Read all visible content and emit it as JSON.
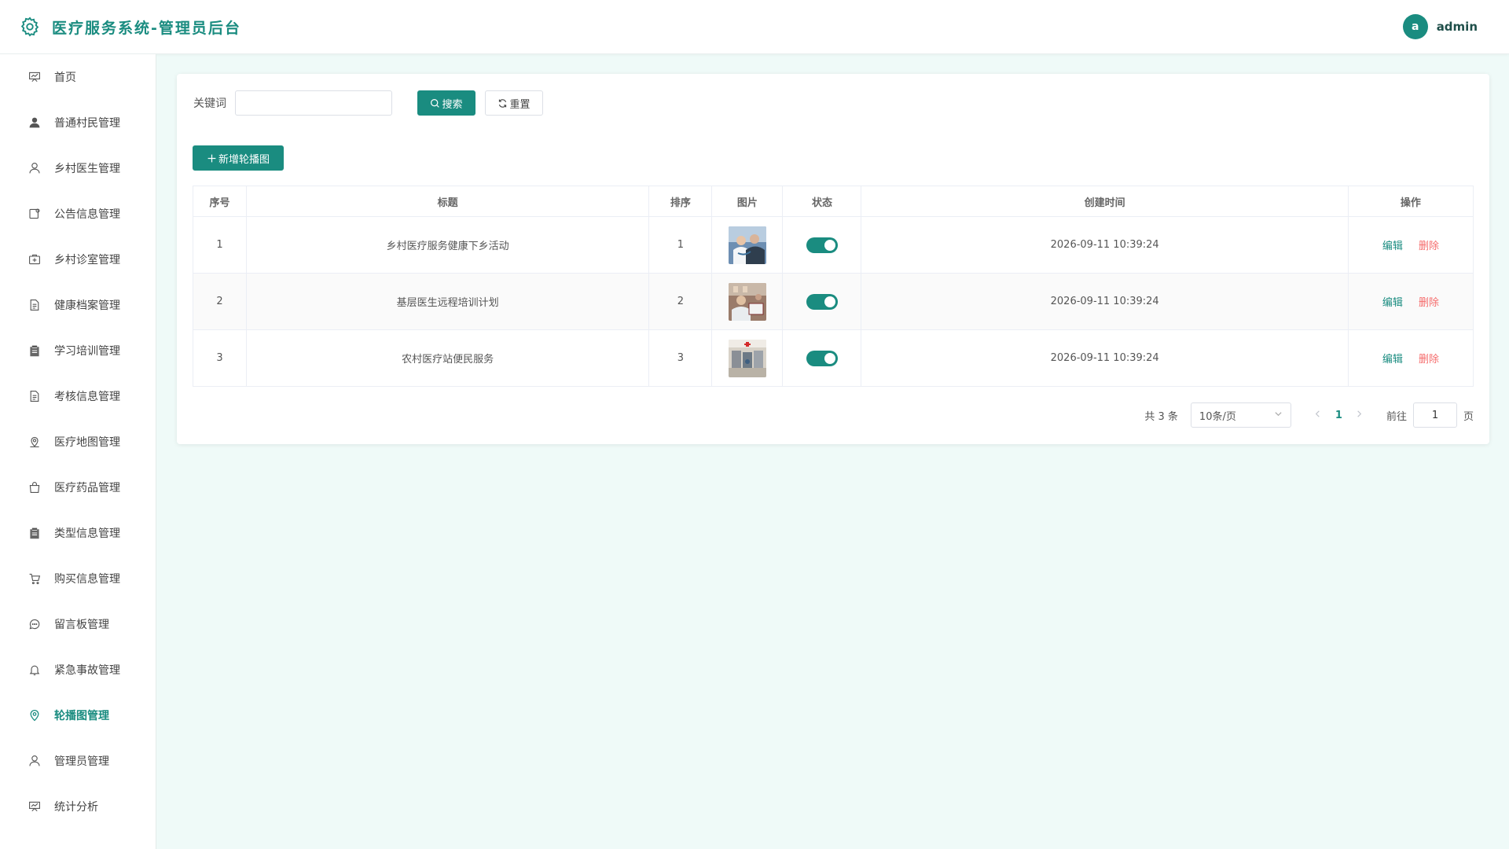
{
  "header": {
    "title": "医疗服务系统-管理员后台",
    "avatar_letter": "a",
    "username": "admin"
  },
  "sidebar": {
    "items": [
      {
        "label": "首页",
        "icon": "presentation-board-icon"
      },
      {
        "label": "普通村民管理",
        "icon": "user-filled-icon"
      },
      {
        "label": "乡村医生管理",
        "icon": "user-icon"
      },
      {
        "label": "公告信息管理",
        "icon": "notice-icon"
      },
      {
        "label": "乡村诊室管理",
        "icon": "first-aid-kit-icon"
      },
      {
        "label": "健康档案管理",
        "icon": "document-icon"
      },
      {
        "label": "学习培训管理",
        "icon": "clipboard-icon"
      },
      {
        "label": "考核信息管理",
        "icon": "document-icon"
      },
      {
        "label": "医疗地图管理",
        "icon": "map-location-icon"
      },
      {
        "label": "医疗药品管理",
        "icon": "shopping-bag-icon"
      },
      {
        "label": "类型信息管理",
        "icon": "clipboard-icon"
      },
      {
        "label": "购买信息管理",
        "icon": "shopping-cart-icon"
      },
      {
        "label": "留言板管理",
        "icon": "chat-bubble-icon"
      },
      {
        "label": "紧急事故管理",
        "icon": "bell-icon"
      },
      {
        "label": "轮播图管理",
        "icon": "location-pin-icon",
        "active": true
      },
      {
        "label": "管理员管理",
        "icon": "user-icon"
      },
      {
        "label": "统计分析",
        "icon": "presentation-board-icon"
      }
    ]
  },
  "search": {
    "keyword_label": "关键词",
    "keyword_value": "",
    "keyword_placeholder": "",
    "search_label": "搜索",
    "reset_label": "重置"
  },
  "toolbar": {
    "add_label": "新增轮播图"
  },
  "table": {
    "headers": [
      "序号",
      "标题",
      "排序",
      "图片",
      "状态",
      "创建时间",
      "操作"
    ],
    "rows": [
      {
        "index": "1",
        "title": "乡村医疗服务健康下乡活动",
        "sort": "1",
        "image": "doctor-examining-patient",
        "status_on": true,
        "created": "2026-09-11 10:39:24",
        "edit": "编辑",
        "delete": "删除"
      },
      {
        "index": "2",
        "title": "基层医生远程培训计划",
        "sort": "2",
        "image": "doctor-consultation",
        "status_on": true,
        "created": "2026-09-11 10:39:24",
        "edit": "编辑",
        "delete": "删除"
      },
      {
        "index": "3",
        "title": "农村医疗站便民服务",
        "sort": "3",
        "image": "clinic-hallway",
        "status_on": true,
        "created": "2026-09-11 10:39:24",
        "edit": "编辑",
        "delete": "删除"
      }
    ]
  },
  "pagination": {
    "total_text": "共 3 条",
    "page_size": "10条/页",
    "current_page": "1",
    "goto_label": "前往",
    "goto_value": "1",
    "page_unit": "页"
  },
  "colors": {
    "accent": "#1a8c80",
    "danger": "#f56c6c",
    "background": "#effaf8"
  }
}
